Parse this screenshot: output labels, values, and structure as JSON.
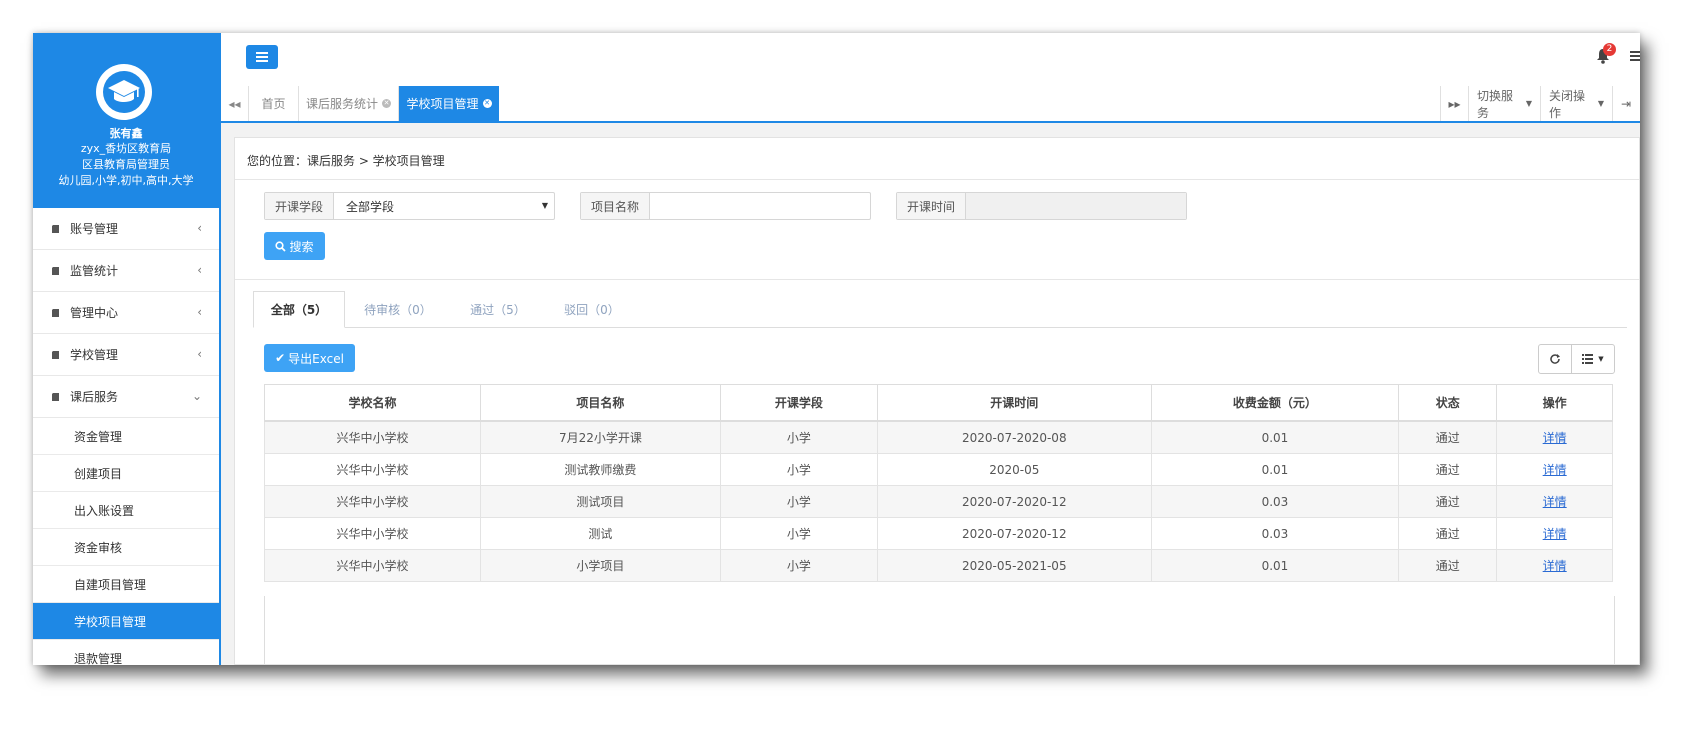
{
  "user": {
    "name": "张有鑫",
    "account": "zyx_香坊区教育局",
    "role": "区县教育局管理员",
    "scope": "幼儿园,小学,初中,高中,大学"
  },
  "sidebar": {
    "menus": [
      {
        "label": "账号管理",
        "chevron": "‹"
      },
      {
        "label": "监管统计",
        "chevron": "‹"
      },
      {
        "label": "管理中心",
        "chevron": "‹"
      },
      {
        "label": "学校管理",
        "chevron": "‹"
      },
      {
        "label": "课后服务",
        "chevron": "⌄"
      }
    ],
    "submenu": [
      {
        "label": "资金管理"
      },
      {
        "label": "创建项目"
      },
      {
        "label": "出入账设置"
      },
      {
        "label": "资金审核"
      },
      {
        "label": "自建项目管理"
      },
      {
        "label": "学校项目管理",
        "active": true
      },
      {
        "label": "退款管理"
      }
    ]
  },
  "topbar": {
    "notification_count": "2"
  },
  "tabs": {
    "items": [
      {
        "label": "首页"
      },
      {
        "label": "课后服务统计"
      },
      {
        "label": "学校项目管理",
        "active": true
      }
    ],
    "switch_service": "切换服务",
    "close_ops": "关闭操作"
  },
  "breadcrumb": "您的位置：课后服务 > 学校项目管理",
  "filters": {
    "stage_label": "开课学段",
    "stage_value": "全部学段",
    "name_label": "项目名称",
    "name_value": "",
    "time_label": "开课时间",
    "time_value": "",
    "search_label": "搜索"
  },
  "status_tabs": [
    {
      "label": "全部（5）",
      "active": true
    },
    {
      "label": "待审核（0）"
    },
    {
      "label": "通过（5）"
    },
    {
      "label": "驳回（0）"
    }
  ],
  "export_label": "导出Excel",
  "table": {
    "headers": [
      "学校名称",
      "项目名称",
      "开课学段",
      "开课时间",
      "收费金额（元）",
      "状态",
      "操作"
    ],
    "rows": [
      [
        "兴华中小学校",
        "7月22小学开课",
        "小学",
        "2020-07-2020-08",
        "0.01",
        "通过",
        "详情"
      ],
      [
        "兴华中小学校",
        "测试教师缴费",
        "小学",
        "2020-05",
        "0.01",
        "通过",
        "详情"
      ],
      [
        "兴华中小学校",
        "测试项目",
        "小学",
        "2020-07-2020-12",
        "0.03",
        "通过",
        "详情"
      ],
      [
        "兴华中小学校",
        "测试",
        "小学",
        "2020-07-2020-12",
        "0.03",
        "通过",
        "详情"
      ],
      [
        "兴华中小学校",
        "小学项目",
        "小学",
        "2020-05-2021-05",
        "0.01",
        "通过",
        "详情"
      ]
    ]
  },
  "colors": {
    "primary": "#1e88e5",
    "button": "#3ea3f5",
    "badge": "#e53935",
    "link": "#2a6ad3"
  }
}
